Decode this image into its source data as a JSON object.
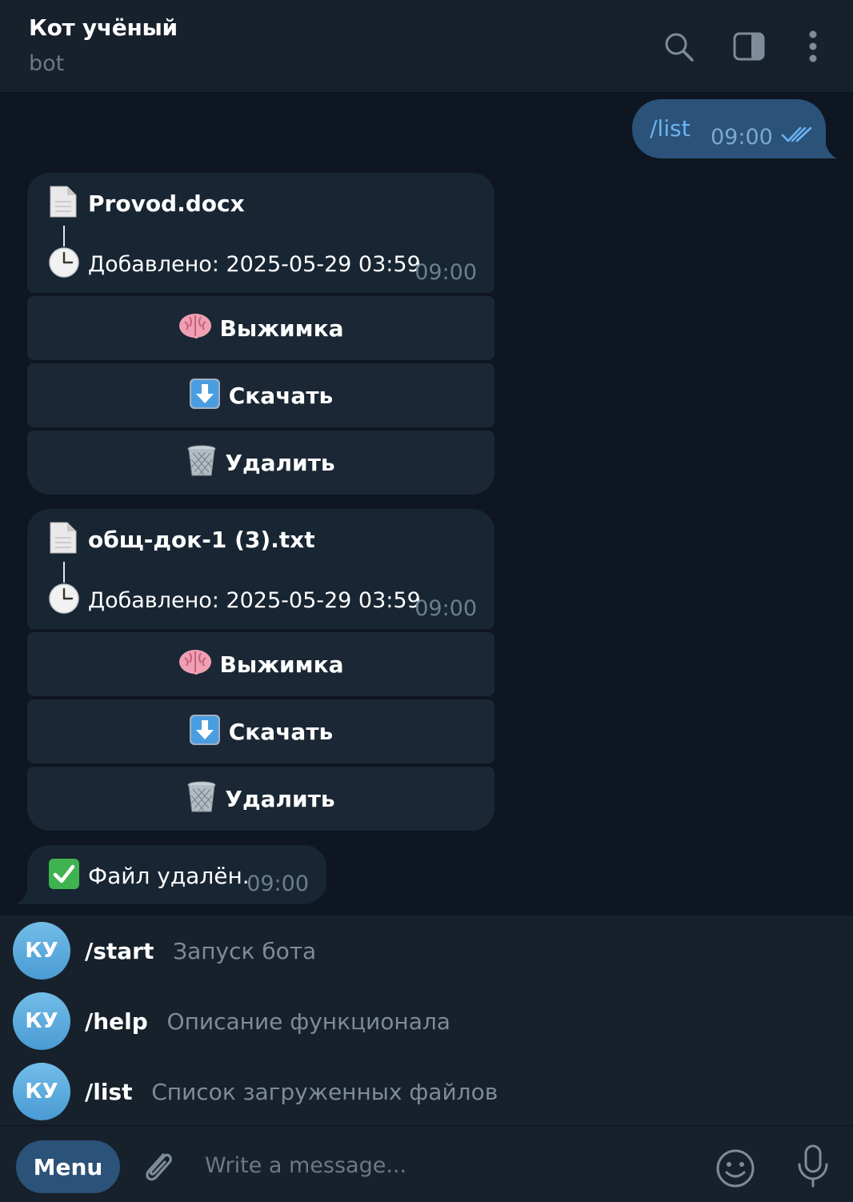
{
  "header": {
    "title": "Кот учёный",
    "subtitle": "bot"
  },
  "outgoing": {
    "text": "/list",
    "time": "09:00"
  },
  "files": [
    {
      "name": "Provod.docx",
      "added": "Добавлено: 2025-05-29 03:59",
      "time": "09:00",
      "buttons": {
        "summary": "Выжимка",
        "download": "Скачать",
        "delete": "Удалить"
      }
    },
    {
      "name": "общ-док-1 (3).txt",
      "added": "Добавлено: 2025-05-29 03:59",
      "time": "09:00",
      "buttons": {
        "summary": "Выжимка",
        "download": "Скачать",
        "delete": "Удалить"
      }
    }
  ],
  "status": {
    "text": "Файл удалён.",
    "time": "09:00"
  },
  "commands": [
    {
      "avatar": "КУ",
      "name": "/start",
      "desc": "Запуск бота"
    },
    {
      "avatar": "КУ",
      "name": "/help",
      "desc": "Описание функционала"
    },
    {
      "avatar": "КУ",
      "name": "/list",
      "desc": "Список загруженных файлов"
    }
  ],
  "input": {
    "menu_label": "Menu",
    "placeholder": "Write a message..."
  },
  "icons": {
    "header": [
      "search-icon",
      "sidebar-toggle-icon",
      "more-vertical-icon"
    ],
    "file": [
      "document-icon",
      "clock-icon"
    ],
    "buttons": [
      "brain-icon",
      "down-arrow-icon",
      "wastebasket-icon"
    ],
    "status": "check-mark-icon",
    "input": [
      "paperclip-icon",
      "smile-icon",
      "microphone-icon"
    ]
  },
  "colors": {
    "chat_bg": "#0e1621",
    "header_bg": "#17212b",
    "bubble_in": "#182533",
    "bubble_out": "#2b5278",
    "accent": "#6ab3f3",
    "muted": "#6c7883"
  }
}
